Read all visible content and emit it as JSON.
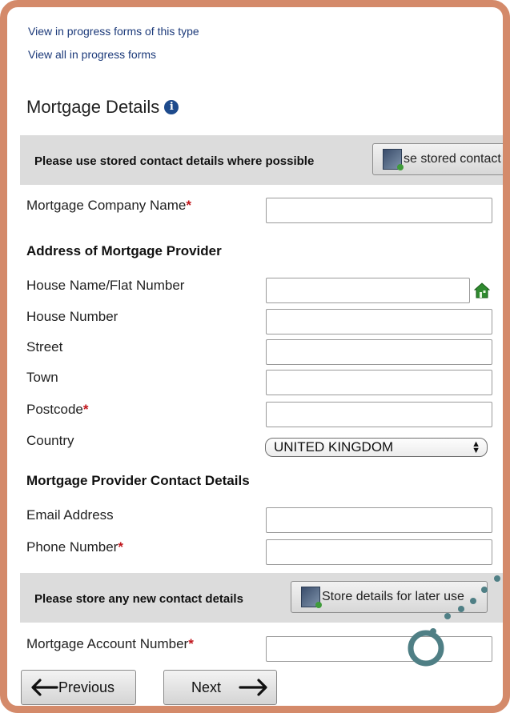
{
  "links": {
    "in_progress_type": "View in progress forms of this type",
    "all_in_progress": "View all in progress forms"
  },
  "page": {
    "title": "Mortgage Details",
    "info_icon": "info-icon"
  },
  "stored_banner": {
    "text": "Please use stored contact details where possible",
    "button_label": "se stored contact d"
  },
  "fields": {
    "mortgage_company_name": {
      "label": "Mortgage Company Name",
      "required": "*",
      "value": ""
    },
    "house_name": {
      "label": "House Name/Flat Number",
      "value": ""
    },
    "house_number": {
      "label": "House Number",
      "value": ""
    },
    "street": {
      "label": "Street",
      "value": ""
    },
    "town": {
      "label": "Town",
      "value": ""
    },
    "postcode": {
      "label": "Postcode",
      "required": "*",
      "value": ""
    },
    "country": {
      "label": "Country",
      "value": "UNITED KINGDOM"
    },
    "email": {
      "label": "Email Address",
      "value": ""
    },
    "phone": {
      "label": "Phone Number",
      "required": "*",
      "value": ""
    },
    "account_number": {
      "label": "Mortgage Account Number",
      "required": "*",
      "value": ""
    }
  },
  "sections": {
    "address": "Address of Mortgage Provider",
    "contact": "Mortgage Provider Contact Details"
  },
  "store_banner": {
    "text": "Please store any new contact details",
    "button_label": "Store details for later use"
  },
  "nav": {
    "previous": "Previous",
    "next": "Next"
  },
  "colors": {
    "frame": "#d48a6a",
    "banner": "#dcdcdc",
    "required": "#c0161c",
    "link": "#1c3a7a",
    "decoration": "#4f7f85"
  }
}
